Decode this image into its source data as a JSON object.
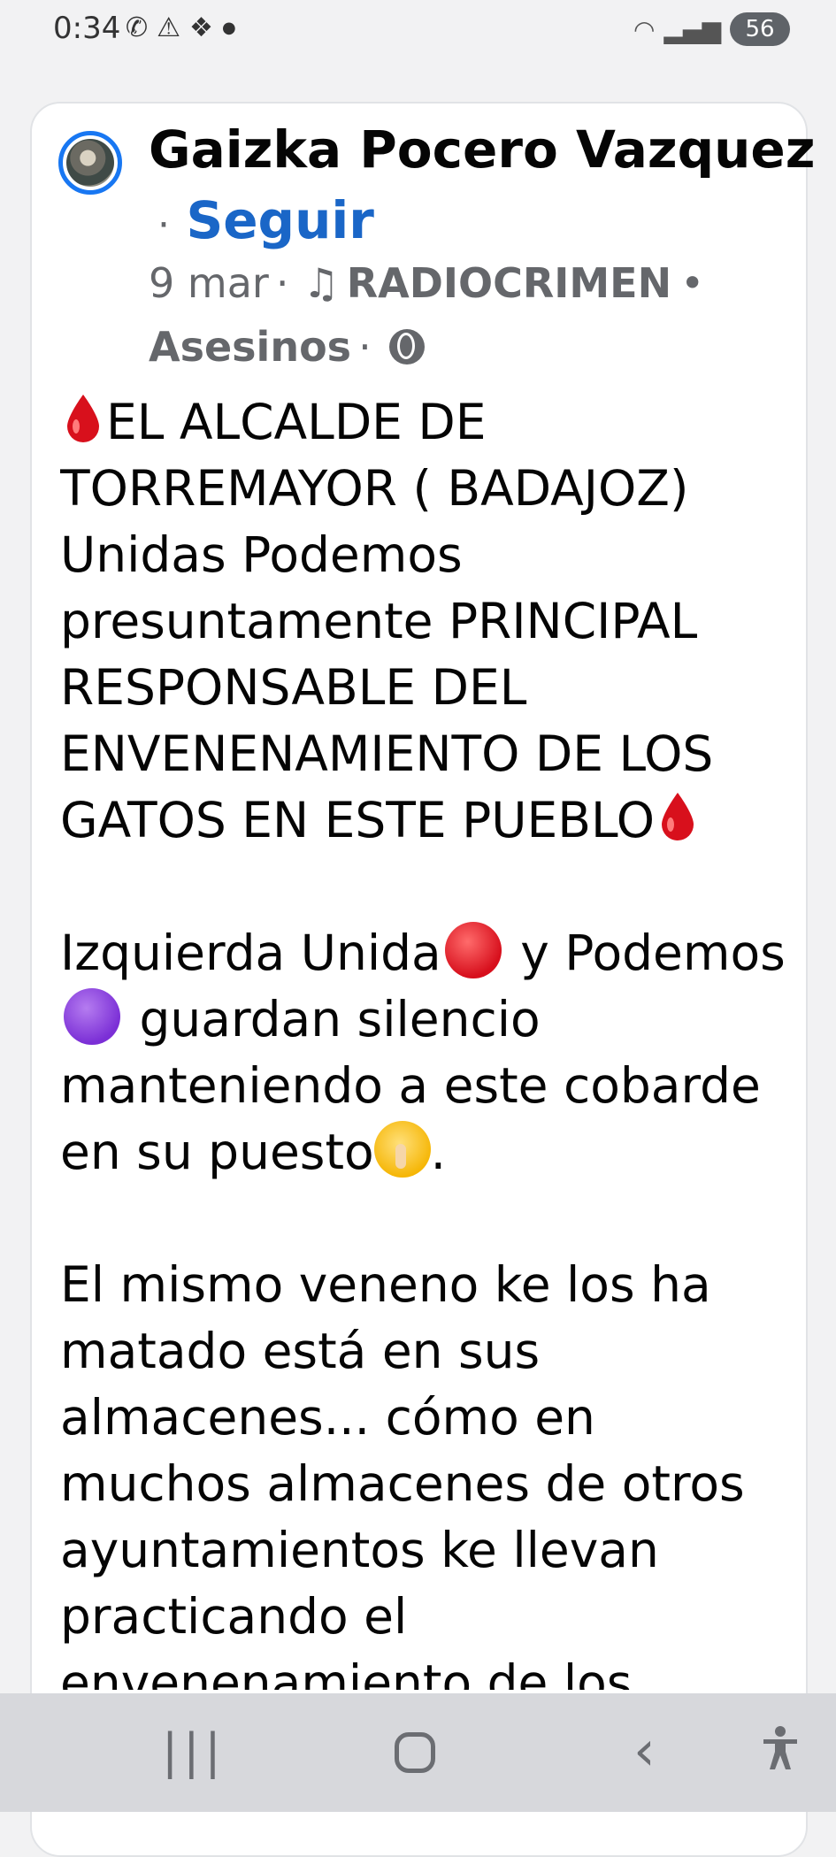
{
  "status_bar": {
    "time": "0:34",
    "left_icons": [
      "whatsapp-icon",
      "alert-icon",
      "layers-icon",
      "dot-icon"
    ],
    "battery": "56"
  },
  "previous_post": {
    "partial_text": "9 mar · ◍"
  },
  "post": {
    "author": "Gaizka Pocero Vazquez",
    "separator": "·",
    "follow_label": "Seguir",
    "date": "9 mar",
    "meta_sep": "·",
    "group_name": "RADIOCRIMEN",
    "group_sep": "•",
    "group_topic": "Asesinos",
    "topic_sep": "·",
    "paragraphs": {
      "p1_text": "EL ALCALDE DE TORREMAYOR ( BADAJOZ) Unidas Podemos presuntamente PRINCIPAL RESPONSABLE DEL ENVENENAMIENTO DE LOS GATOS EN ESTE PUEBLO",
      "p2_a": "Izquierda Unida",
      "p2_b": " y Podemos",
      "p2_c": " guardan silencio manteniendo a este cobarde en su puesto",
      "p2_d": ".",
      "p3_text": "El mismo veneno ke los ha matado está en sus almacenes... cómo en muchos almacenes de otros ayuntamientos ke llevan practicando el envenenamiento de los"
    }
  },
  "nav_bar": {
    "recent_glyph": "|||",
    "back_glyph": "‹",
    "accessibility_glyph": "⚲"
  },
  "colors": {
    "accent": "#1877f2",
    "follow": "#1a66c7",
    "secondary_text": "#65676b"
  }
}
